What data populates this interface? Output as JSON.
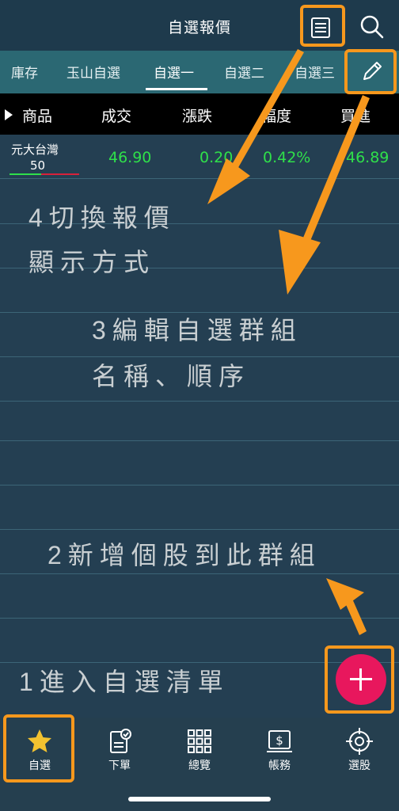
{
  "header": {
    "title": "自選報價",
    "icons": [
      "list-icon",
      "search-icon"
    ]
  },
  "tabs": [
    {
      "label": "庫存",
      "active": false
    },
    {
      "label": "玉山自選",
      "active": false
    },
    {
      "label": "自選一",
      "active": true
    },
    {
      "label": "自選二",
      "active": false
    },
    {
      "label": "自選三",
      "active": false
    }
  ],
  "columns": [
    "商品",
    "成交",
    "漲跌",
    "幅度",
    "買進"
  ],
  "rows": [
    {
      "name": "元大台灣",
      "code": "50",
      "price": "46.90",
      "change": "0.20",
      "percent": "0.42%",
      "bid": "46.89"
    }
  ],
  "annotations": {
    "step4_line1": "4切換報價",
    "step4_line2": "顯示方式",
    "step3_line1": "3編輯自選群組",
    "step3_line2": "名稱、順序",
    "step2": "2新增個股到此群組",
    "step1": "1進入自選清單"
  },
  "fab": {
    "icon": "plus-icon"
  },
  "bottom_nav": [
    {
      "label": "自選",
      "icon": "star-icon"
    },
    {
      "label": "下單",
      "icon": "order-icon"
    },
    {
      "label": "總覽",
      "icon": "grid-icon"
    },
    {
      "label": "帳務",
      "icon": "account-icon"
    },
    {
      "label": "選股",
      "icon": "target-icon"
    }
  ],
  "colors": {
    "background": "#243f52",
    "tab_bar": "#2b6873",
    "up_green": "#2fe04a",
    "highlight_orange": "#f7981d",
    "fab_pink": "#e8175d"
  }
}
